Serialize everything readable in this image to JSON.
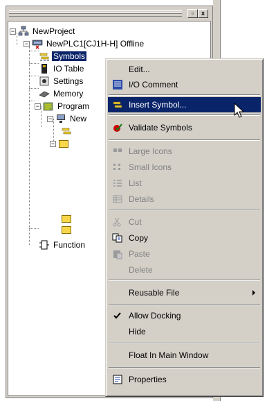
{
  "tree": {
    "root": "NewProject",
    "plc": "NewPLC1[CJ1H-H] Offline",
    "items": [
      "Symbols",
      "IO Table",
      "Settings",
      "Memory",
      "Program",
      "New",
      "Function"
    ]
  },
  "menu": {
    "items": [
      {
        "label": "Edit...",
        "icon": "none",
        "enabled": true
      },
      {
        "label": "I/O Comment",
        "icon": "io-comment-icon",
        "enabled": true
      },
      {
        "label": "Insert Symbol...",
        "icon": "insert-symbol-icon",
        "enabled": true,
        "highlighted": true
      },
      {
        "label": "Validate Symbols",
        "icon": "validate-icon",
        "enabled": true
      },
      {
        "label": "Large Icons",
        "icon": "large-icons-icon",
        "enabled": false
      },
      {
        "label": "Small Icons",
        "icon": "small-icons-icon",
        "enabled": false
      },
      {
        "label": "List",
        "icon": "list-icon",
        "enabled": false
      },
      {
        "label": "Details",
        "icon": "details-icon",
        "enabled": false
      },
      {
        "label": "Cut",
        "icon": "scissors-icon",
        "enabled": false
      },
      {
        "label": "Copy",
        "icon": "copy-icon",
        "enabled": true
      },
      {
        "label": "Paste",
        "icon": "paste-icon",
        "enabled": false
      },
      {
        "label": "Delete",
        "icon": "none",
        "enabled": false
      },
      {
        "label": "Reusable File",
        "icon": "none",
        "enabled": true,
        "submenu": true
      },
      {
        "label": "Allow Docking",
        "icon": "check-icon",
        "enabled": true,
        "checked": true
      },
      {
        "label": "Hide",
        "icon": "none",
        "enabled": true
      },
      {
        "label": "Float In Main Window",
        "icon": "none",
        "enabled": true
      },
      {
        "label": "Properties",
        "icon": "properties-icon",
        "enabled": true
      }
    ]
  },
  "caption_buttons": {
    "restore": "▫",
    "close": "x"
  }
}
